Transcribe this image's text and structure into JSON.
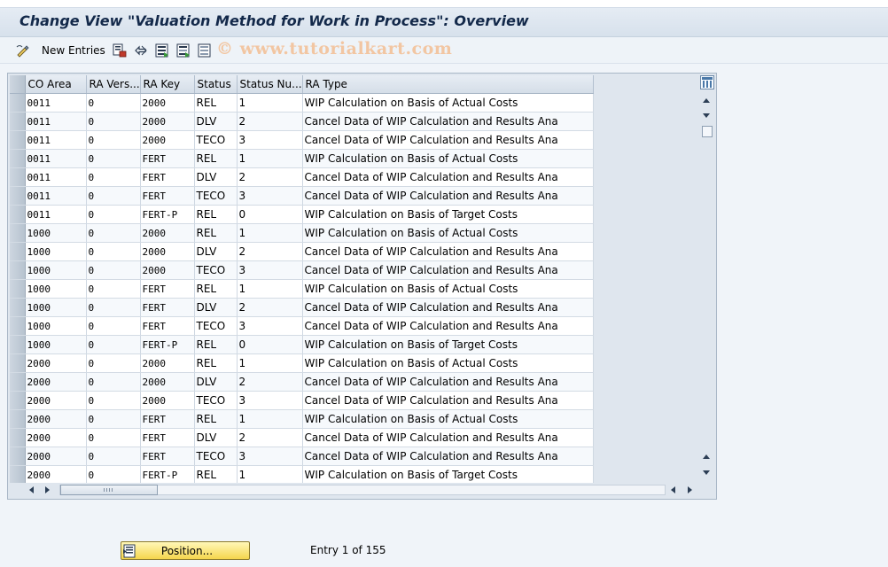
{
  "window": {
    "title": "Change View \"Valuation Method for Work in Process\": Overview"
  },
  "toolbar": {
    "new_entries_label": "New Entries",
    "watermark": "© www.tutorialkart.com",
    "icons": [
      "display-change-icon",
      "copy-icon",
      "undo-icon",
      "select-all-icon",
      "select-block-icon",
      "deselect-all-icon"
    ]
  },
  "table": {
    "columns": [
      "CO Area",
      "RA Vers...",
      "RA Key",
      "Status",
      "Status Nu...",
      "RA Type"
    ],
    "rows": [
      [
        "0011",
        "0",
        "2000",
        "REL",
        "1",
        "WIP Calculation on Basis of Actual Costs"
      ],
      [
        "0011",
        "0",
        "2000",
        "DLV",
        "2",
        "Cancel Data of WIP Calculation and Results Ana"
      ],
      [
        "0011",
        "0",
        "2000",
        "TECO",
        "3",
        "Cancel Data of WIP Calculation and Results Ana"
      ],
      [
        "0011",
        "0",
        "FERT",
        "REL",
        "1",
        "WIP Calculation on Basis of Actual Costs"
      ],
      [
        "0011",
        "0",
        "FERT",
        "DLV",
        "2",
        "Cancel Data of WIP Calculation and Results Ana"
      ],
      [
        "0011",
        "0",
        "FERT",
        "TECO",
        "3",
        "Cancel Data of WIP Calculation and Results Ana"
      ],
      [
        "0011",
        "0",
        "FERT-P",
        "REL",
        "0",
        "WIP Calculation on Basis of Target Costs"
      ],
      [
        "1000",
        "0",
        "2000",
        "REL",
        "1",
        "WIP Calculation on Basis of Actual Costs"
      ],
      [
        "1000",
        "0",
        "2000",
        "DLV",
        "2",
        "Cancel Data of WIP Calculation and Results Ana"
      ],
      [
        "1000",
        "0",
        "2000",
        "TECO",
        "3",
        "Cancel Data of WIP Calculation and Results Ana"
      ],
      [
        "1000",
        "0",
        "FERT",
        "REL",
        "1",
        "WIP Calculation on Basis of Actual Costs"
      ],
      [
        "1000",
        "0",
        "FERT",
        "DLV",
        "2",
        "Cancel Data of WIP Calculation and Results Ana"
      ],
      [
        "1000",
        "0",
        "FERT",
        "TECO",
        "3",
        "Cancel Data of WIP Calculation and Results Ana"
      ],
      [
        "1000",
        "0",
        "FERT-P",
        "REL",
        "0",
        "WIP Calculation on Basis of Target Costs"
      ],
      [
        "2000",
        "0",
        "2000",
        "REL",
        "1",
        "WIP Calculation on Basis of Actual Costs"
      ],
      [
        "2000",
        "0",
        "2000",
        "DLV",
        "2",
        "Cancel Data of WIP Calculation and Results Ana"
      ],
      [
        "2000",
        "0",
        "2000",
        "TECO",
        "3",
        "Cancel Data of WIP Calculation and Results Ana"
      ],
      [
        "2000",
        "0",
        "FERT",
        "REL",
        "1",
        "WIP Calculation on Basis of Actual Costs"
      ],
      [
        "2000",
        "0",
        "FERT",
        "DLV",
        "2",
        "Cancel Data of WIP Calculation and Results Ana"
      ],
      [
        "2000",
        "0",
        "FERT",
        "TECO",
        "3",
        "Cancel Data of WIP Calculation and Results Ana"
      ],
      [
        "2000",
        "0",
        "FERT-P",
        "REL",
        "1",
        "WIP Calculation on Basis of Target Costs"
      ]
    ]
  },
  "footer": {
    "position_button_label": "Position...",
    "entry_info": "Entry 1 of 155"
  },
  "colors": {
    "title_text": "#13294a",
    "button_yellow": "#f5d64d",
    "watermark": "#f2c6a2"
  }
}
